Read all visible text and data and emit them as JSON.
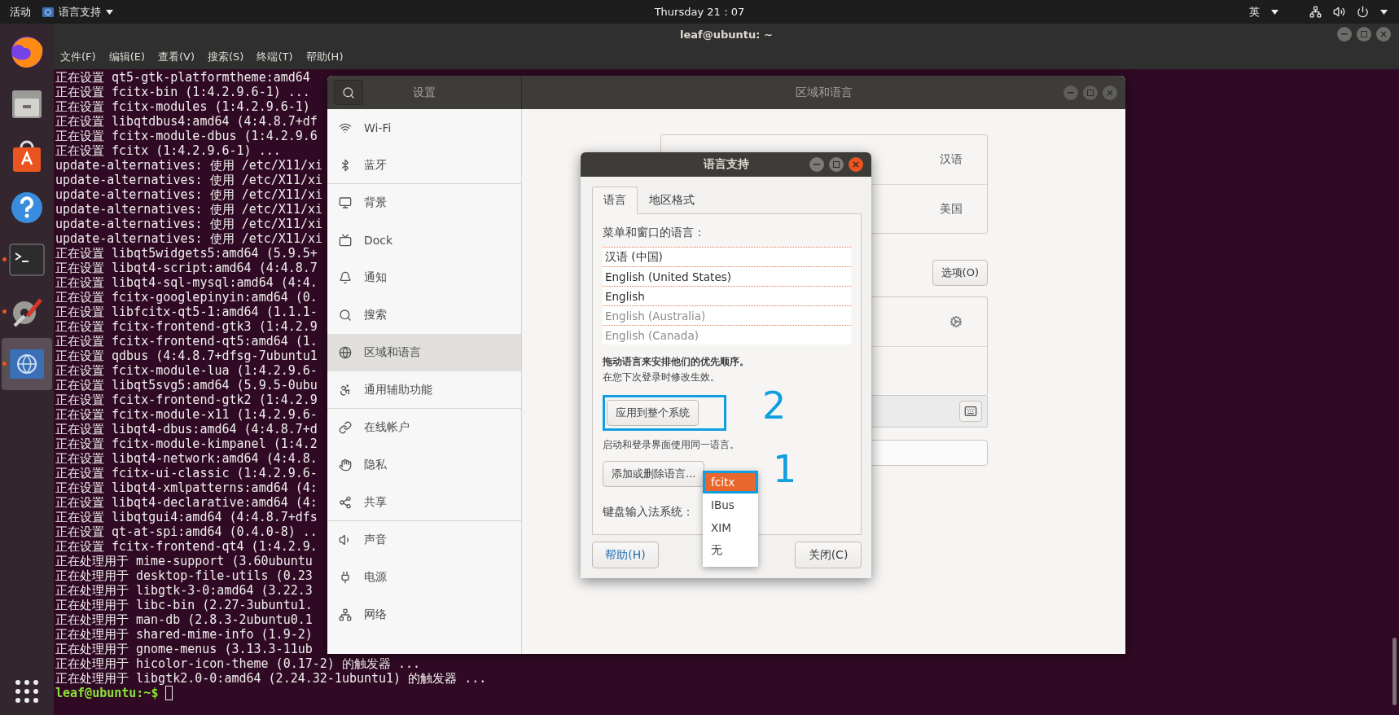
{
  "top_bar": {
    "activities": "活动",
    "app_menu": "语言支持",
    "clock": "Thursday 21：07",
    "input_method": "英"
  },
  "dock": {
    "items": [
      {
        "running": false,
        "selected": false
      },
      {
        "running": false,
        "selected": false
      },
      {
        "running": false,
        "selected": false
      },
      {
        "running": false,
        "selected": false
      },
      {
        "running": true,
        "selected": false
      },
      {
        "running": true,
        "selected": false
      },
      {
        "running": true,
        "selected": true
      }
    ]
  },
  "terminal": {
    "title": "leaf@ubuntu: ~",
    "menu": [
      "文件(F)",
      "编辑(E)",
      "查看(V)",
      "搜索(S)",
      "终端(T)",
      "帮助(H)"
    ],
    "lines": [
      "正在设置 qt5-gtk-platformtheme:amd64",
      "正在设置 fcitx-bin (1:4.2.9.6-1) ...",
      "正在设置 fcitx-modules (1:4.2.9.6-1)",
      "正在设置 libqtdbus4:amd64 (4:4.8.7+df",
      "正在设置 fcitx-module-dbus (1:4.2.9.6",
      "正在设置 fcitx (1:4.2.9.6-1) ...",
      "update-alternatives: 使用 /etc/X11/xi",
      "update-alternatives: 使用 /etc/X11/xi",
      "update-alternatives: 使用 /etc/X11/xi",
      "update-alternatives: 使用 /etc/X11/xi",
      "update-alternatives: 使用 /etc/X11/xi",
      "update-alternatives: 使用 /etc/X11/xi",
      "正在设置 libqt5widgets5:amd64 (5.9.5+",
      "正在设置 libqt4-script:amd64 (4:4.8.7",
      "正在设置 libqt4-sql-mysql:amd64 (4:4.",
      "正在设置 fcitx-googlepinyin:amd64 (0.",
      "正在设置 libfcitx-qt5-1:amd64 (1.1.1-",
      "正在设置 fcitx-frontend-gtk3 (1:4.2.9",
      "正在设置 fcitx-frontend-qt5:amd64 (1.",
      "正在设置 qdbus (4:4.8.7+dfsg-7ubuntu1",
      "正在设置 fcitx-module-lua (1:4.2.9.6-",
      "正在设置 libqt5svg5:amd64 (5.9.5-0ubu",
      "正在设置 fcitx-frontend-gtk2 (1:4.2.9",
      "正在设置 fcitx-module-x11 (1:4.2.9.6-",
      "正在设置 libqt4-dbus:amd64 (4:4.8.7+d",
      "正在设置 fcitx-module-kimpanel (1:4.2",
      "正在设置 libqt4-network:amd64 (4:4.8.",
      "正在设置 fcitx-ui-classic (1:4.2.9.6-",
      "正在设置 libqt4-xmlpatterns:amd64 (4:",
      "正在设置 libqt4-declarative:amd64 (4:",
      "正在设置 libqtgui4:amd64 (4:4.8.7+dfs",
      "正在设置 qt-at-spi:amd64 (0.4.0-8) ..",
      "正在设置 fcitx-frontend-qt4 (1:4.2.9.",
      "正在处理用于 mime-support (3.60ubuntu",
      "正在处理用于 desktop-file-utils (0.23",
      "正在处理用于 libgtk-3-0:amd64 (3.22.3",
      "正在处理用于 libc-bin (2.27-3ubuntu1.",
      "正在处理用于 man-db (2.8.3-2ubuntu0.1",
      "正在处理用于 shared-mime-info (1.9-2)",
      "正在处理用于 gnome-menus (3.13.3-11ub",
      "正在处理用于 hicolor-icon-theme (0.17-2) 的触发器 ...",
      "正在处理用于 libgtk2.0-0:amd64 (2.24.32-1ubuntu1) 的触发器 ..."
    ],
    "prompt": "leaf@ubuntu:~$"
  },
  "settings": {
    "title": "设置",
    "panel_title": "区域和语言",
    "sidebar": [
      {
        "label": "Wi-Fi",
        "selected": false,
        "divider_after": false
      },
      {
        "label": "蓝牙",
        "selected": false,
        "divider_after": true
      },
      {
        "label": "背景",
        "selected": false,
        "divider_after": false
      },
      {
        "label": "Dock",
        "selected": false,
        "divider_after": false
      },
      {
        "label": "通知",
        "selected": false,
        "divider_after": false
      },
      {
        "label": "搜索",
        "selected": false,
        "divider_after": false
      },
      {
        "label": "区域和语言",
        "selected": true,
        "divider_after": false
      },
      {
        "label": "通用辅助功能",
        "selected": false,
        "divider_after": true
      },
      {
        "label": "在线帐户",
        "selected": false,
        "divider_after": false
      },
      {
        "label": "隐私",
        "selected": false,
        "divider_after": false
      },
      {
        "label": "共享",
        "selected": false,
        "divider_after": true
      },
      {
        "label": "声音",
        "selected": false,
        "divider_after": false
      },
      {
        "label": "电源",
        "selected": false,
        "divider_after": false
      },
      {
        "label": "网络",
        "selected": false,
        "divider_after": false
      }
    ],
    "language_rows": [
      "汉语",
      "美国"
    ],
    "options_button": "选项(O)"
  },
  "dialog": {
    "title": "语言支持",
    "tabs": [
      {
        "label": "语言",
        "selected": true
      },
      {
        "label": "地区格式",
        "selected": false
      }
    ],
    "list_label": "菜单和窗口的语言：",
    "languages": [
      {
        "label": "汉语 (中国)",
        "dimmed": false
      },
      {
        "label": "English (United States)",
        "dimmed": false
      },
      {
        "label": "English",
        "dimmed": false
      },
      {
        "label": "English (Australia)",
        "dimmed": true
      },
      {
        "label": "English (Canada)",
        "dimmed": true
      }
    ],
    "hint_bold": "拖动语言来安排他们的优先顺序。",
    "hint": "在您下次登录时修改生效。",
    "apply_button": {
      "label": "应用到整个系统",
      "annotation": "2"
    },
    "apply_note": "启动和登录界面使用同一语言。",
    "add_button": "添加或删除语言...",
    "im_label": "键盘输入法系统：",
    "im_menu": [
      {
        "label": "fcitx",
        "selected": true,
        "annotation": "1"
      },
      {
        "label": "IBus",
        "selected": false
      },
      {
        "label": "XIM",
        "selected": false
      },
      {
        "label": "无",
        "selected": false
      }
    ],
    "help_button": "帮助(H)",
    "close_button": "关闭(C)"
  }
}
